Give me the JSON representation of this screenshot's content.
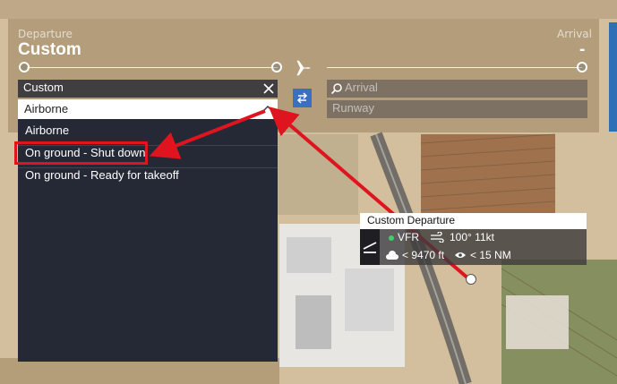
{
  "departure": {
    "label": "Departure",
    "name": "Custom",
    "search_value": "Custom",
    "state_selected": "Airborne",
    "state_options": [
      "Airborne",
      "On ground - Shut down",
      "On ground - Ready for takeoff"
    ],
    "highlighted_option": "On ground - Shut down"
  },
  "arrival": {
    "label": "Arrival",
    "name": "-",
    "search_placeholder": "Arrival",
    "runway_placeholder": "Runway"
  },
  "map_card": {
    "title": "Custom Departure",
    "flight_rules": "VFR",
    "wind": "100° 11kt",
    "clouds": "< 9470 ft",
    "visibility": "< 15 NM"
  },
  "icons": {
    "plane": "plane-icon",
    "swap": "swap-icon",
    "search": "search-icon",
    "clear": "close-icon",
    "chevron": "chevron-up-icon"
  },
  "colors": {
    "annotation_red": "#e0141e",
    "dropdown_bg": "#252936",
    "swap_blue": "#3b6fc0",
    "vfr_green": "#3ecf6a"
  }
}
